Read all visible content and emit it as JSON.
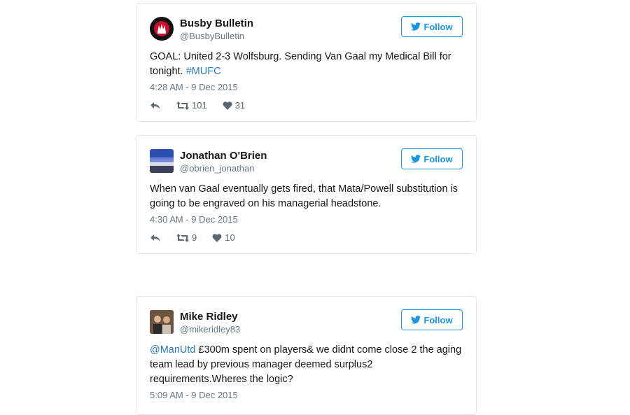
{
  "tweets": [
    {
      "name": "Busby Bulletin",
      "handle": "@BusbyBulletin",
      "follow_label": "Follow",
      "text_parts": {
        "before": "GOAL: United 2-3 Wolfsburg. Sending Van Gaal my Medical Bill for tonight. ",
        "link": "#MUFC",
        "after": ""
      },
      "time": "4:28 AM - 9 Dec 2015",
      "retweets": "101",
      "likes": "31"
    },
    {
      "name": "Jonathan O'Brien",
      "handle": "@obrien_jonathan",
      "follow_label": "Follow",
      "text_parts": {
        "before": "When van Gaal eventually gets fired, that Mata/Powell substitution is going to be engraved on his managerial headstone.",
        "link": "",
        "after": ""
      },
      "time": "4:30 AM - 9 Dec 2015",
      "retweets": "9",
      "likes": "10"
    },
    {
      "name": "Mike Ridley",
      "handle": "@mikeridley83",
      "follow_label": "Follow",
      "text_parts": {
        "before": "",
        "link": "@ManUtd",
        "after": " £300m spent on players& we didnt come close 2 the aging team lead by previous manager deemed surplus2 requirements.Wheres the logic?"
      },
      "time": "5:09 AM - 9 Dec 2015"
    }
  ],
  "colors": {
    "accent": "#1b95e0",
    "link": "#2b7bb9",
    "muted": "#657786"
  },
  "icons": {
    "follow": "twitter-bird-icon",
    "reply": "reply-icon",
    "retweet": "retweet-icon",
    "like": "heart-icon"
  }
}
